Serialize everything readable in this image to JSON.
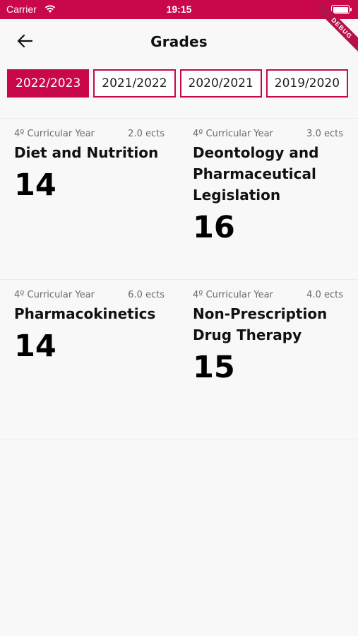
{
  "status_bar": {
    "carrier": "Carrier",
    "time": "19:15"
  },
  "debug_ribbon": "DEBUG",
  "header": {
    "title": "Grades"
  },
  "tabs": [
    {
      "label": "2022/2023",
      "active": true
    },
    {
      "label": "2021/2022",
      "active": false
    },
    {
      "label": "2020/2021",
      "active": false
    },
    {
      "label": "2019/2020",
      "active": false
    }
  ],
  "courses": [
    {
      "year": "4º Curricular Year",
      "ects": "2.0 ects",
      "name": "Diet and Nutrition",
      "grade": "14"
    },
    {
      "year": "4º Curricular Year",
      "ects": "3.0 ects",
      "name": "Deontology and Pharmaceutical Legislation",
      "grade": "16"
    },
    {
      "year": "4º Curricular Year",
      "ects": "6.0 ects",
      "name": "Pharmacokinetics",
      "grade": "14"
    },
    {
      "year": "4º Curricular Year",
      "ects": "4.0 ects",
      "name": "Non-Prescription Drug Therapy",
      "grade": "15"
    }
  ],
  "colors": {
    "accent": "#c8084a",
    "background": "#f8f8f8"
  }
}
